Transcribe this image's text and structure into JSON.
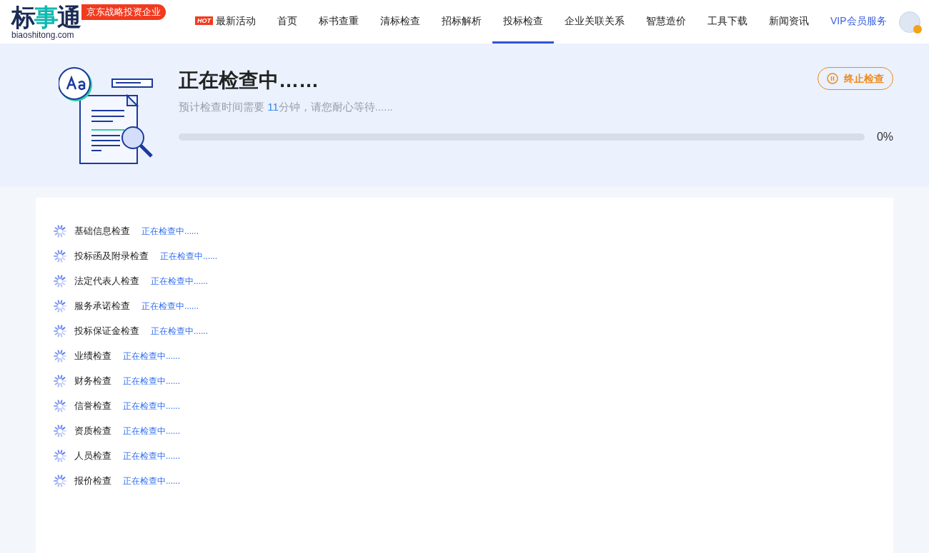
{
  "header": {
    "logo": {
      "chars": [
        "标",
        "事",
        "通"
      ],
      "domain": "biaoshitong.com"
    },
    "tagline": "京东战略投资企业",
    "nav": [
      {
        "label": "最新活动",
        "badge": "HOT",
        "kind": "normal",
        "selected": false
      },
      {
        "label": "首页",
        "kind": "normal",
        "selected": false
      },
      {
        "label": "标书查重",
        "kind": "normal",
        "selected": false
      },
      {
        "label": "清标检查",
        "kind": "normal",
        "selected": false
      },
      {
        "label": "招标解析",
        "kind": "normal",
        "selected": false
      },
      {
        "label": "投标检查",
        "kind": "normal",
        "selected": true
      },
      {
        "label": "企业关联关系",
        "kind": "normal",
        "selected": false
      },
      {
        "label": "智慧造价",
        "kind": "normal",
        "selected": false
      },
      {
        "label": "工具下载",
        "kind": "normal",
        "selected": false
      },
      {
        "label": "新闻资讯",
        "kind": "normal",
        "selected": false
      },
      {
        "label": "VIP会员服务",
        "kind": "vip",
        "selected": false
      }
    ]
  },
  "banner": {
    "title": "正在检查中……",
    "subtitle_before": "预计检查时间需要 ",
    "minutes": "11",
    "subtitle_after": "分钟，请您耐心等待......",
    "stop_button": "终止检查",
    "progress": {
      "level": 0,
      "reading": "0%"
    }
  },
  "checks": [
    {
      "name": "基础信息检查",
      "status": "正在检查中......"
    },
    {
      "name": "投标函及附录检查",
      "status": "正在检查中......"
    },
    {
      "name": "法定代表人检查",
      "status": "正在检查中......"
    },
    {
      "name": "服务承诺检查",
      "status": "正在检查中......"
    },
    {
      "name": "投标保证金检查",
      "status": "正在检查中......"
    },
    {
      "name": "业绩检查",
      "status": "正在检查中......"
    },
    {
      "name": "财务检查",
      "status": "正在检查中......"
    },
    {
      "name": "信誉检查",
      "status": "正在检查中......"
    },
    {
      "name": "资质检查",
      "status": "正在检查中......"
    },
    {
      "name": "人员检查",
      "status": "正在检查中......"
    },
    {
      "name": "报价检查",
      "status": "正在检查中......"
    }
  ]
}
